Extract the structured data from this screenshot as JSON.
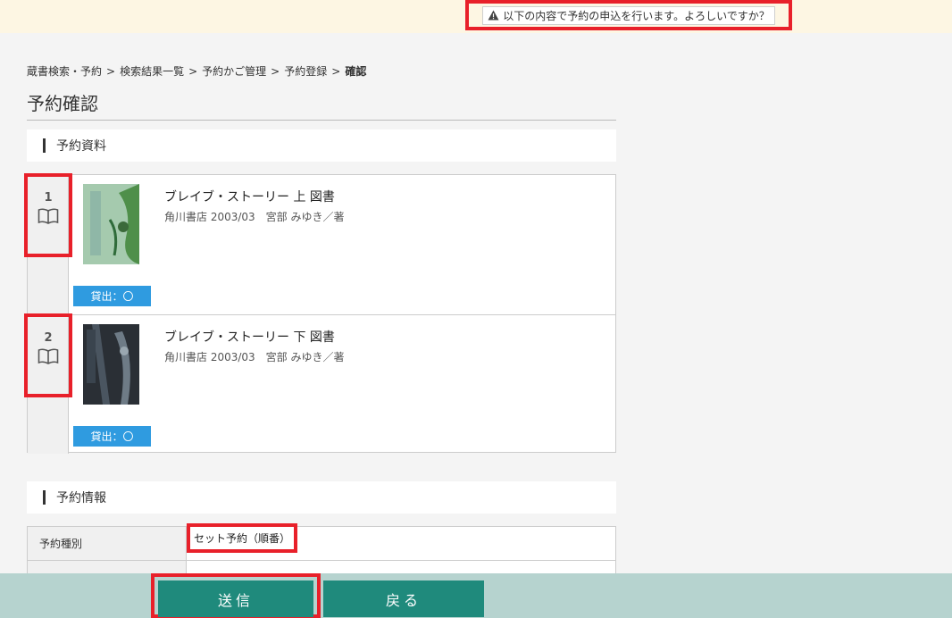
{
  "notice": {
    "text": "以下の内容で予約の申込を行います。よろしいですか？",
    "icon": "warning-icon"
  },
  "breadcrumb": [
    {
      "label": "蔵書検索・予約"
    },
    {
      "label": "検索結果一覧"
    },
    {
      "label": "予約かご管理"
    },
    {
      "label": "予約登録"
    },
    {
      "label": "確認"
    }
  ],
  "breadcrumb_separator": ">",
  "page_title": "予約確認",
  "section_materials": "予約資料",
  "items": [
    {
      "number": "1",
      "title": "ブレイブ・ストーリー 上 図書",
      "meta": "角川書店 2003/03　宮部 みゆき／著",
      "badge": "貸出：〇"
    },
    {
      "number": "2",
      "title": "ブレイブ・ストーリー 下 図書",
      "meta": "角川書店 2003/03　宮部 みゆき／著",
      "badge": "貸出：〇"
    }
  ],
  "section_info": "予約情報",
  "info_rows": [
    {
      "label": "予約種別",
      "value": "セット予約（順番）"
    }
  ],
  "buttons": {
    "send": "送信",
    "back": "戻る"
  },
  "colors": {
    "accent": "#1f8a7c",
    "badge": "#2f9be0",
    "highlight": "#e8202a",
    "footer": "#b6d3cf"
  }
}
